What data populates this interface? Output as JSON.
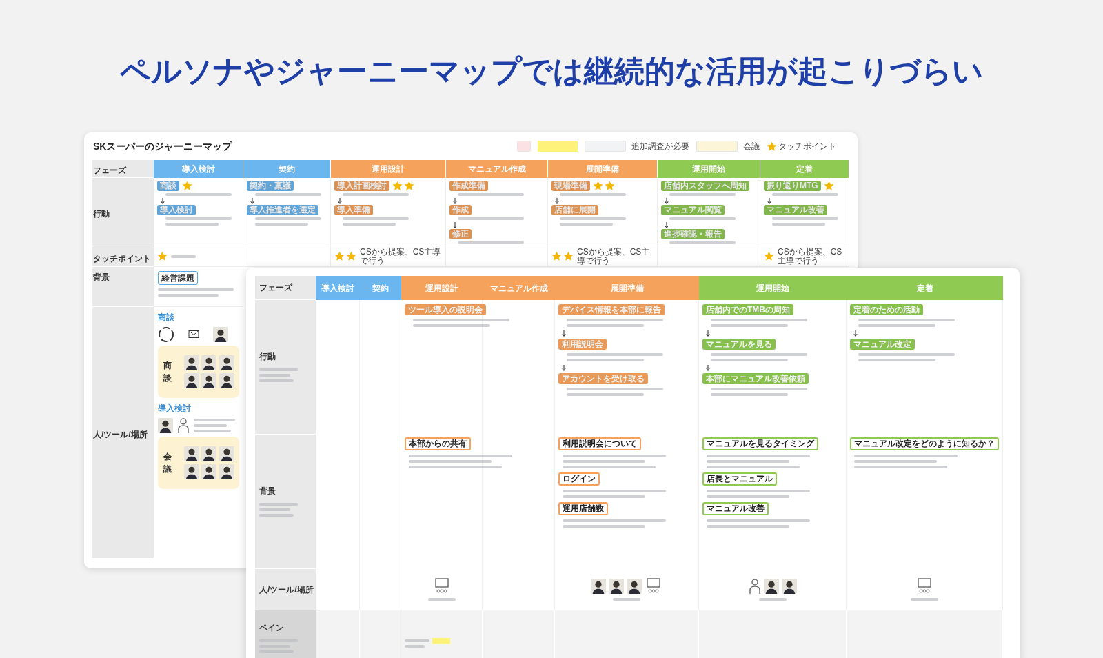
{
  "headline": "ペルソナやジャーニーマップでは継続的な活用が起こりづらい",
  "back_map": {
    "title": "SKスーパーのジャーニーマップ",
    "legend": [
      {
        "kind": "swatch",
        "color": "#fbe0e4"
      },
      {
        "kind": "highlight",
        "color": "#fff27a"
      },
      {
        "kind": "swatch",
        "color": "#f1f3f5",
        "label": "追加調査が必要"
      },
      {
        "kind": "swatch",
        "color": "#fdf5d8",
        "label": "会議"
      },
      {
        "kind": "star",
        "label": "タッチポイント"
      }
    ],
    "row_labels": [
      "フェーズ",
      "行動",
      "タッチポイント",
      "背景",
      "人/ツール/場所"
    ],
    "columns": [
      {
        "label": "導入検討",
        "color": "#6cb6ef",
        "actions": [
          {
            "label": "商談",
            "marks": [
              {
                "kind": "star"
              }
            ]
          },
          {
            "label": "導入検討"
          }
        ],
        "touchpoint": {
          "marks": [
            {
              "kind": "star"
            }
          ]
        }
      },
      {
        "label": "契約",
        "color": "#6cb6ef",
        "actions": [
          {
            "label": "契約・稟議"
          },
          {
            "label": "導入推進者を選定"
          }
        ]
      },
      {
        "label": "運用設計",
        "color": "#f5a25d",
        "actions": [
          {
            "label": "導入計画検討",
            "marks": [
              {
                "kind": "star"
              },
              {
                "kind": "star"
              }
            ]
          },
          {
            "label": "導入準備"
          }
        ],
        "touchpoint": {
          "marks": [
            {
              "kind": "star"
            },
            {
              "kind": "star"
            }
          ],
          "text": "CSから提案、CS主導で行う"
        }
      },
      {
        "label": "マニュアル作成",
        "color": "#f5a25d",
        "actions": [
          {
            "label": "作成準備"
          },
          {
            "label": "作成"
          },
          {
            "label": "修正"
          }
        ]
      },
      {
        "label": "展開準備",
        "color": "#f5a25d",
        "actions": [
          {
            "label": "現場準備",
            "marks": [
              {
                "kind": "star"
              },
              {
                "kind": "star"
              }
            ]
          },
          {
            "label": "店舗に展開"
          }
        ],
        "touchpoint": {
          "marks": [
            {
              "kind": "star"
            },
            {
              "kind": "star"
            }
          ],
          "text": "CSから提案、CS主導で行う"
        }
      },
      {
        "label": "運用開始",
        "color": "#8fca52",
        "actions": [
          {
            "label": "店舗内スタッフへ周知"
          },
          {
            "label": "マニュアル閲覧"
          },
          {
            "label": "進捗確認・報告"
          }
        ]
      },
      {
        "label": "定着",
        "color": "#8fca52",
        "actions": [
          {
            "label": "振り返りMTG",
            "marks": [
              {
                "kind": "star"
              }
            ]
          },
          {
            "label": "マニュアル改善"
          }
        ],
        "touchpoint": {
          "marks": [
            {
              "kind": "star"
            }
          ],
          "text": "CSから提案、CS主導で行う"
        }
      }
    ],
    "background_tag": "経営課題",
    "people_sections": [
      {
        "label": "商談",
        "meeting": "商談"
      },
      {
        "label": "導入検討",
        "meeting": "会議"
      }
    ]
  },
  "front_map": {
    "row_labels": [
      "フェーズ",
      "行動",
      "背景",
      "人/ツール/場所",
      "ペイン"
    ],
    "columns": [
      {
        "label": "導入検討",
        "color": "#6cb6ef"
      },
      {
        "label": "契約",
        "color": "#6cb6ef"
      },
      {
        "label": "運用設計",
        "color": "#f5a25d",
        "actions": [
          {
            "label": "ツール導入の説明会"
          }
        ],
        "backgrounds": [
          {
            "label": "本部からの共有"
          }
        ],
        "people": [
          {
            "kind": "screen"
          }
        ],
        "pain": true
      },
      {
        "label": "マニュアル作成",
        "color": "#f5a25d"
      },
      {
        "label": "展開準備",
        "color": "#f5a25d",
        "actions": [
          {
            "label": "デバイス情報を本部に報告"
          },
          {
            "label": "利用説明会"
          },
          {
            "label": "アカウントを受け取る"
          }
        ],
        "backgrounds": [
          {
            "label": "利用説明会について"
          },
          {
            "label": "ログイン"
          },
          {
            "label": "運用店舗数"
          }
        ],
        "people": [
          {
            "kind": "person"
          },
          {
            "kind": "person"
          },
          {
            "kind": "person"
          },
          {
            "kind": "screen"
          }
        ]
      },
      {
        "label": "運用開始",
        "color": "#8fca52",
        "actions": [
          {
            "label": "店舗内でのTMBの周知"
          },
          {
            "label": "マニュアルを見る"
          },
          {
            "label": "本部にマニュアル改善依頼"
          }
        ],
        "backgrounds": [
          {
            "label": "マニュアルを見るタイミング"
          },
          {
            "label": "店長とマニュアル"
          },
          {
            "label": "マニュアル改善"
          }
        ],
        "people": [
          {
            "kind": "staff"
          },
          {
            "kind": "person"
          },
          {
            "kind": "person"
          }
        ]
      },
      {
        "label": "定着",
        "color": "#8fca52",
        "actions": [
          {
            "label": "定着のための活動"
          },
          {
            "label": "マニュアル改定"
          }
        ],
        "backgrounds": [
          {
            "label": "マニュアル改定をどのように知るか？"
          }
        ],
        "people": [
          {
            "kind": "screen"
          }
        ]
      }
    ]
  }
}
